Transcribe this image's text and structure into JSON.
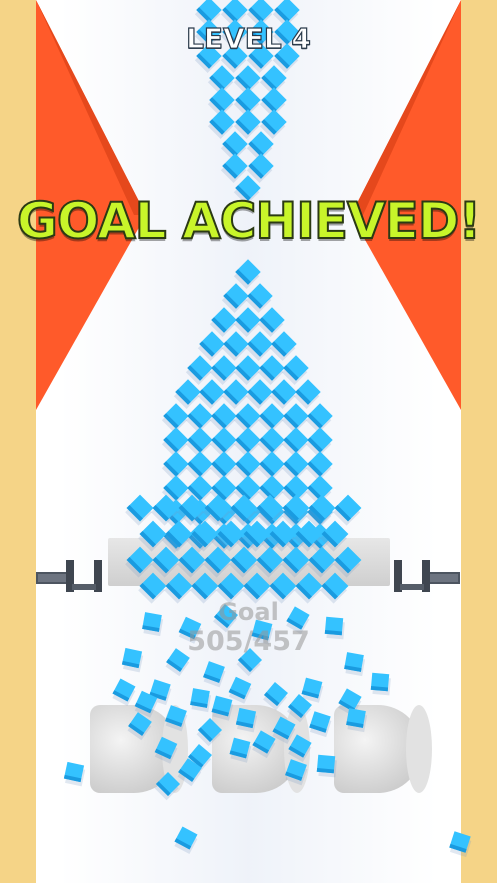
{
  "hud": {
    "level_label": "LEVEL 4",
    "status_banner": "GOAL ACHIEVED!",
    "goal_label": "Goal",
    "goal_count": "505/457"
  },
  "colors": {
    "cube": "#34c2ff",
    "cube_dark": "#1a9be0",
    "triangle": "#ff5a2a",
    "side_wall": "#f5d487",
    "banner_text": "#c8f52a"
  }
}
